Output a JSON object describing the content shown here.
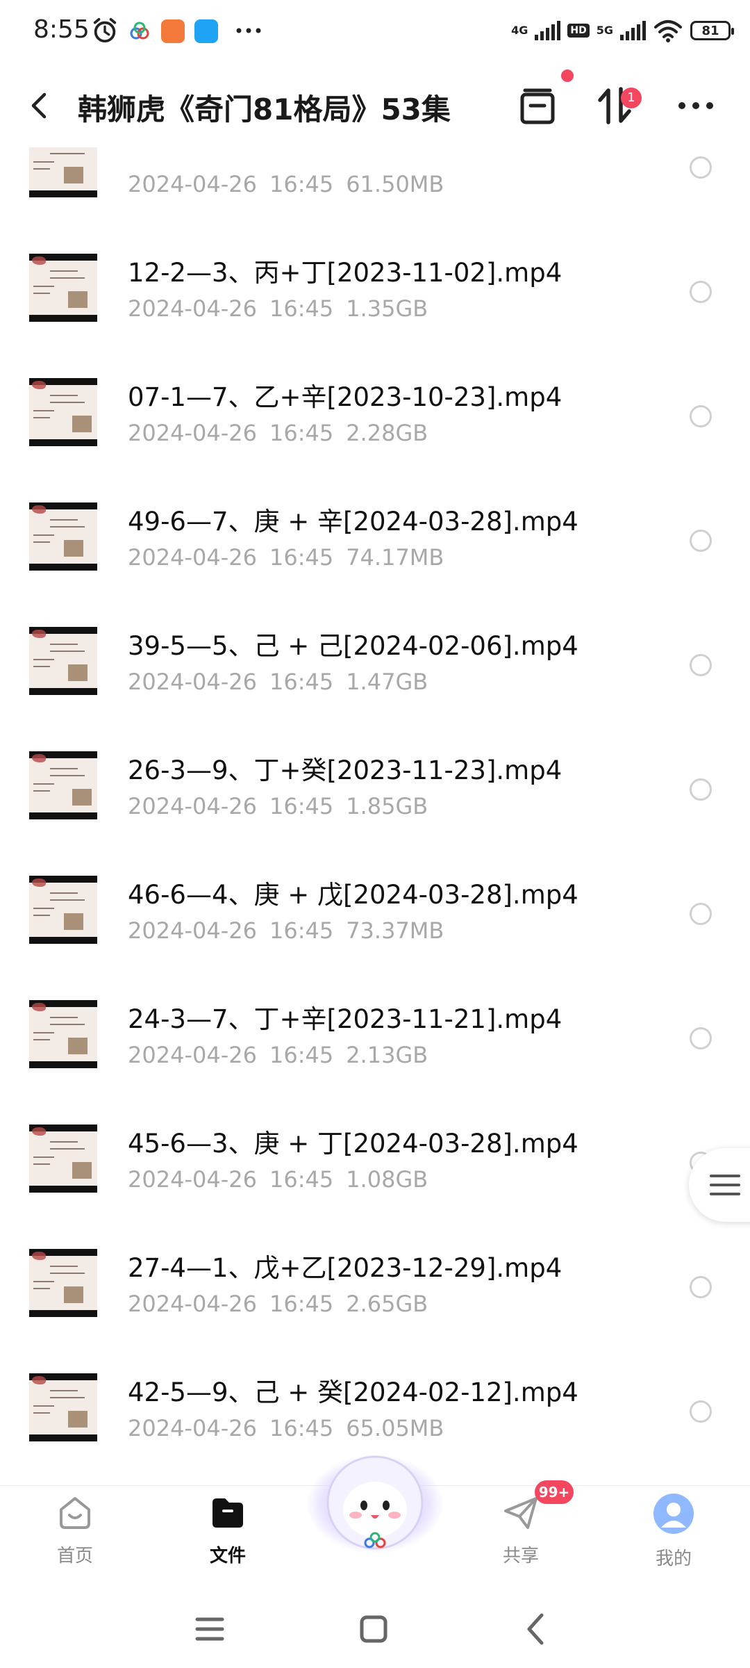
{
  "status_bar": {
    "time": "8:55",
    "network1": "4G",
    "hd": "HD",
    "network2": "5G",
    "battery": "81"
  },
  "header": {
    "title": "韩狮虎《奇门81格局》53集",
    "transfer_badge": "1"
  },
  "files": [
    {
      "name": "",
      "date": "2024-04-26",
      "time": "16:45",
      "size": "61.50MB"
    },
    {
      "name": "12-2—3、丙+丁[2023-11-02].mp4",
      "date": "2024-04-26",
      "time": "16:45",
      "size": "1.35GB"
    },
    {
      "name": "07-1—7、乙+辛[2023-10-23].mp4",
      "date": "2024-04-26",
      "time": "16:45",
      "size": "2.28GB"
    },
    {
      "name": "49-6—7、庚 + 辛[2024-03-28].mp4",
      "date": "2024-04-26",
      "time": "16:45",
      "size": "74.17MB"
    },
    {
      "name": "39-5—5、己 + 己[2024-02-06].mp4",
      "date": "2024-04-26",
      "time": "16:45",
      "size": "1.47GB"
    },
    {
      "name": "26-3—9、丁+癸[2023-11-23].mp4",
      "date": "2024-04-26",
      "time": "16:45",
      "size": "1.85GB"
    },
    {
      "name": "46-6—4、庚 + 戊[2024-03-28].mp4",
      "date": "2024-04-26",
      "time": "16:45",
      "size": "73.37MB"
    },
    {
      "name": "24-3—7、丁+辛[2023-11-21].mp4",
      "date": "2024-04-26",
      "time": "16:45",
      "size": "2.13GB"
    },
    {
      "name": "45-6—3、庚 + 丁[2024-03-28].mp4",
      "date": "2024-04-26",
      "time": "16:45",
      "size": "1.08GB"
    },
    {
      "name": "27-4—1、戊+乙[2023-12-29].mp4",
      "date": "2024-04-26",
      "time": "16:45",
      "size": "2.65GB"
    },
    {
      "name": "42-5—9、己 + 癸[2024-02-12].mp4",
      "date": "2024-04-26",
      "time": "16:45",
      "size": "65.05MB"
    }
  ],
  "bottom_nav": {
    "home": "首页",
    "files": "文件",
    "share": "共享",
    "mine": "我的",
    "share_badge": "99+"
  },
  "colors": {
    "accent_red": "#f4465f",
    "meta_gray": "#a8a8a8"
  }
}
